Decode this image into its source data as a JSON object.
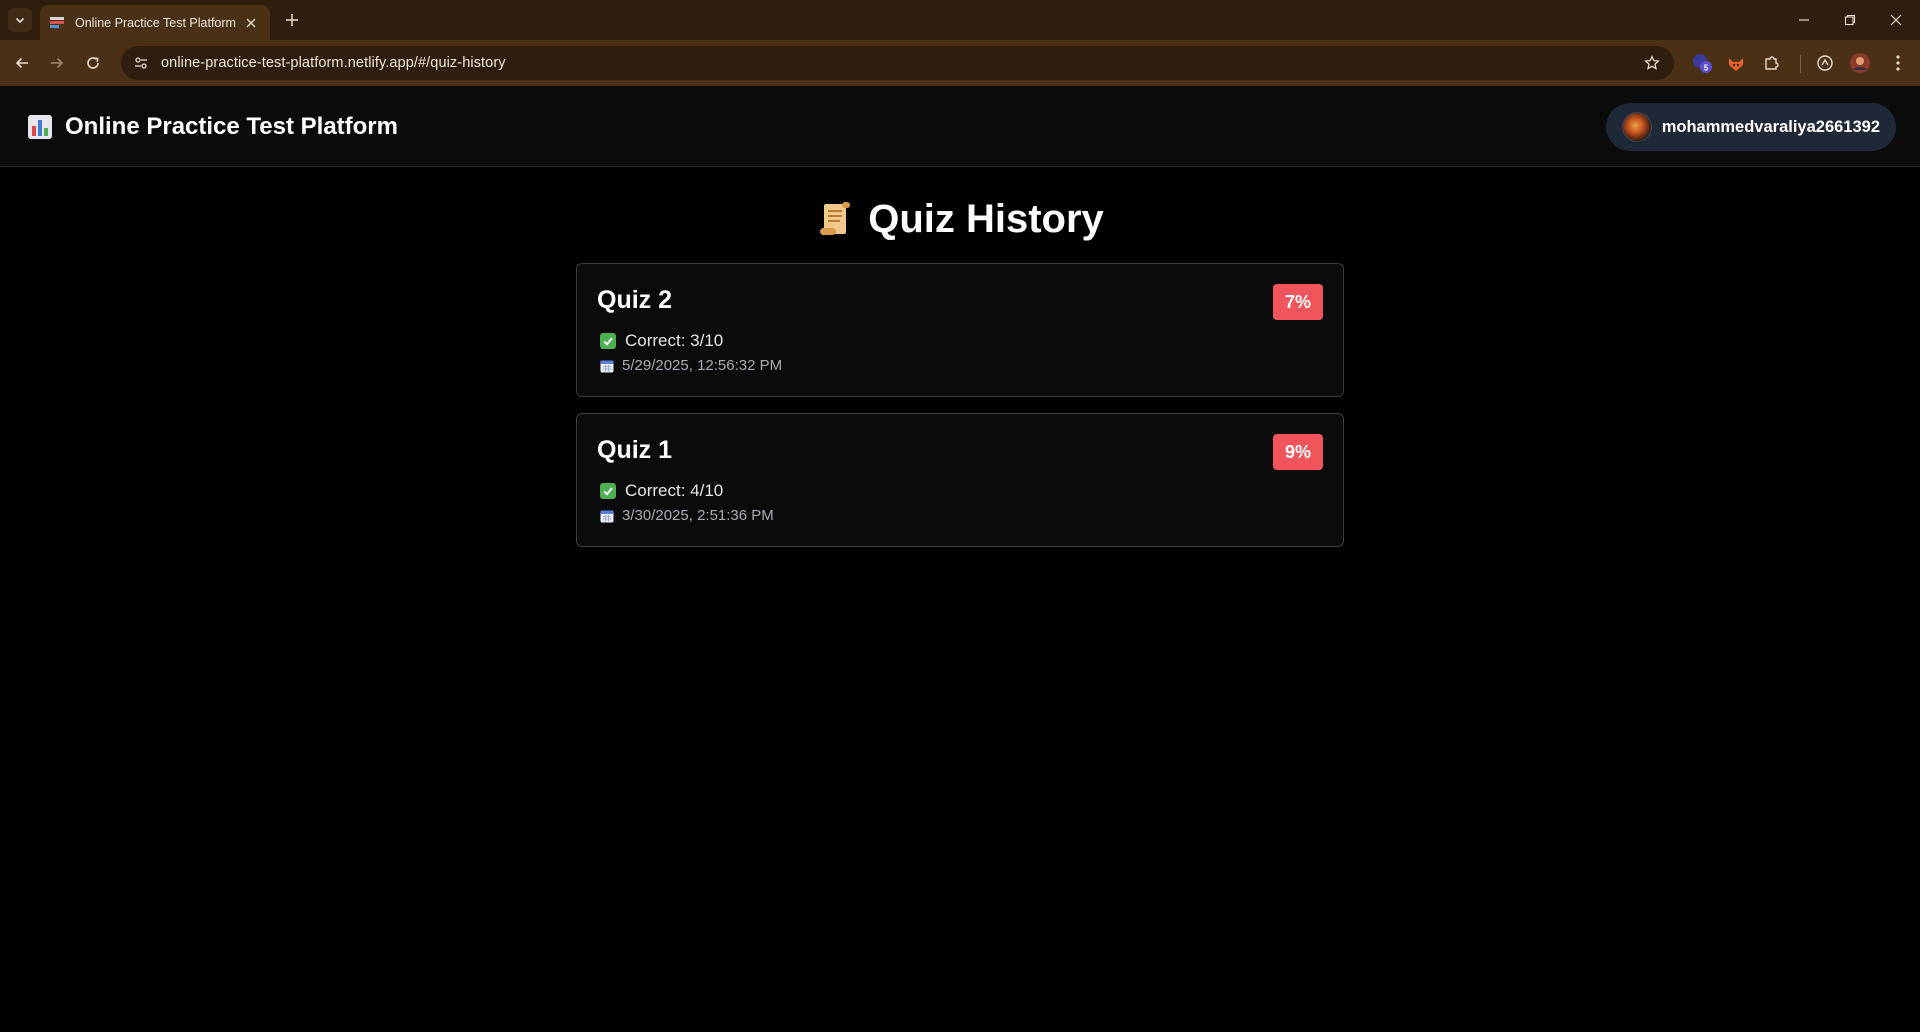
{
  "browser": {
    "tab_title": "Online Practice Test Platform",
    "url": "online-practice-test-platform.netlify.app/#/quiz-history",
    "extension_badge": "5",
    "accent": "#4a3116",
    "frame": "#2f1e0e"
  },
  "header": {
    "brand_icon": "bar-chart-icon",
    "title": "Online Practice Test Platform",
    "username": "mohammedvaraliya2661392"
  },
  "page": {
    "title_icon": "scroll-icon",
    "title": "Quiz History"
  },
  "quizzes": [
    {
      "name": "Quiz 2",
      "score": "7%",
      "correct": "Correct: 3/10",
      "date": "5/29/2025, 12:56:32 PM"
    },
    {
      "name": "Quiz 1",
      "score": "9%",
      "correct": "Correct: 4/10",
      "date": "3/30/2025, 2:51:36 PM"
    }
  ],
  "colors": {
    "score_badge": "#f0555c",
    "check": "#4caf50",
    "user_pill": "#1e2836"
  }
}
